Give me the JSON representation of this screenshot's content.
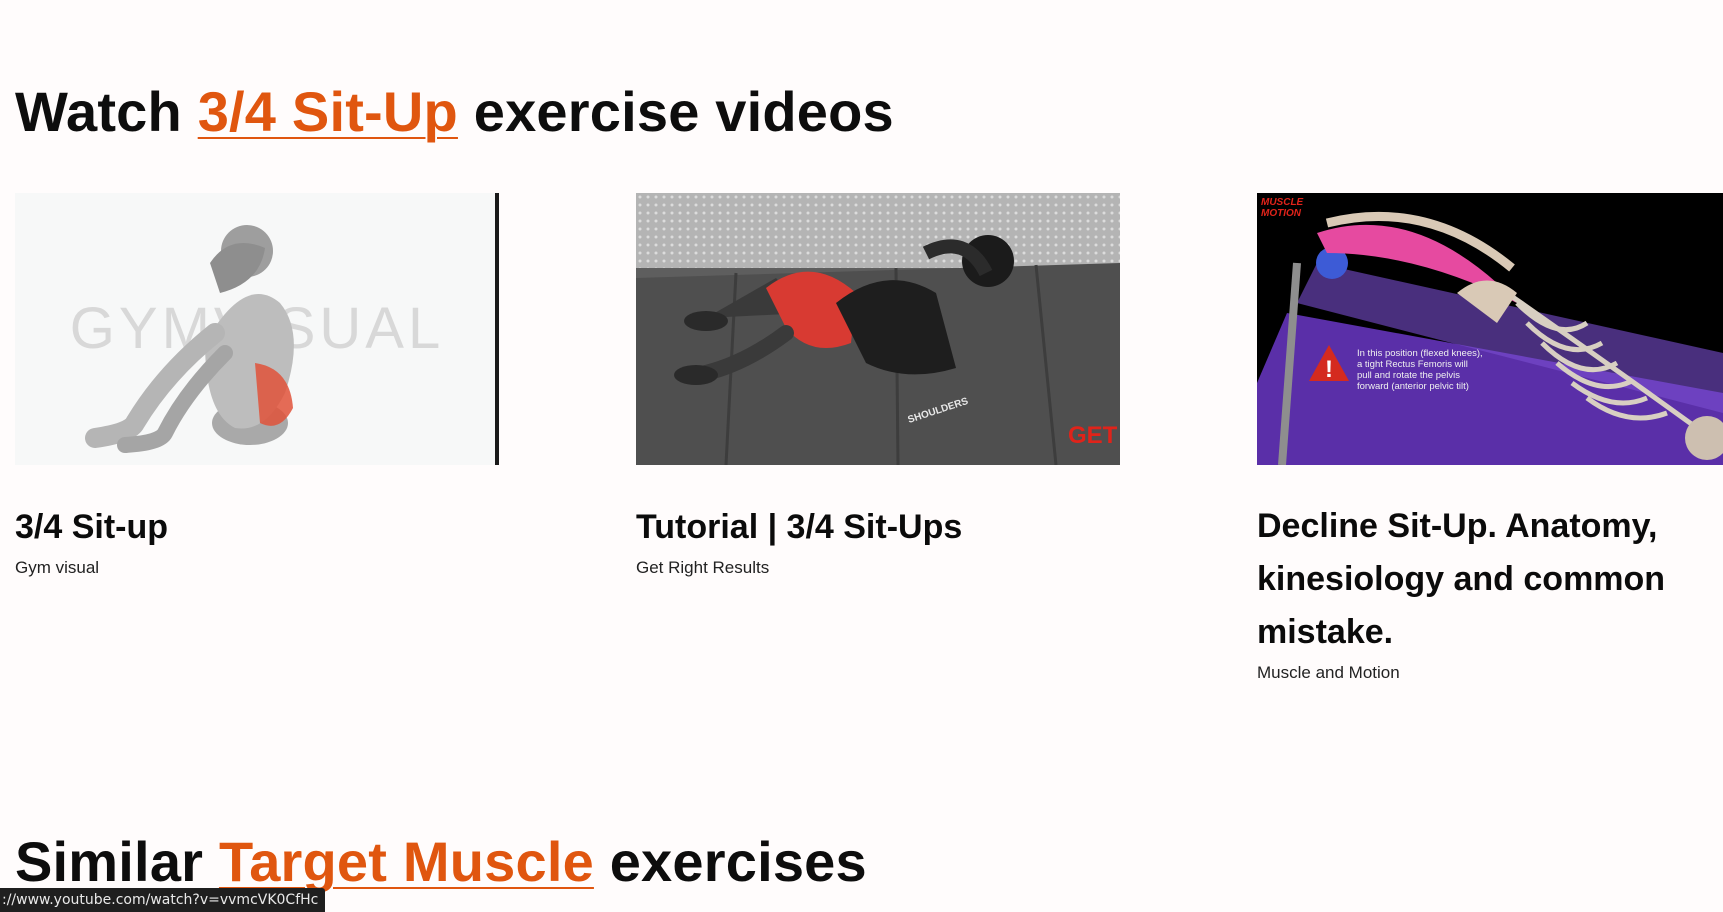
{
  "videos_section": {
    "prefix": "Watch",
    "link": "3/4 Sit-Up",
    "suffix": "exercise videos"
  },
  "videos": [
    {
      "title": "3/4 Sit-up",
      "channel": "Gym visual",
      "thumbnail_watermark": "GYMVISUAL"
    },
    {
      "title": "Tutorial | 3/4 Sit-Ups",
      "channel": "Get Right Results",
      "thumbnail_overlay": "GET R",
      "thumbnail_brand": "SHOULDERS"
    },
    {
      "title": "Decline Sit-Up. Anatomy, kinesiology and common mistake.",
      "channel": "Muscle and Motion",
      "thumbnail_logo": [
        "MUSCLE",
        "MOTION"
      ],
      "thumbnail_caption": [
        "In this position (flexed knees),",
        "a tight Rectus Femoris will",
        "pull and rotate the pelvis",
        "forward (anterior pelvic tilt)"
      ]
    }
  ],
  "similar_section": {
    "prefix": "Similar",
    "link": "Target Muscle",
    "suffix": "exercises"
  },
  "status_bar": {
    "url": "://www.youtube.com/watch?v=vvmcVK0CfHc"
  },
  "colors": {
    "accent": "#e0560f",
    "background": "#fffcfc"
  }
}
